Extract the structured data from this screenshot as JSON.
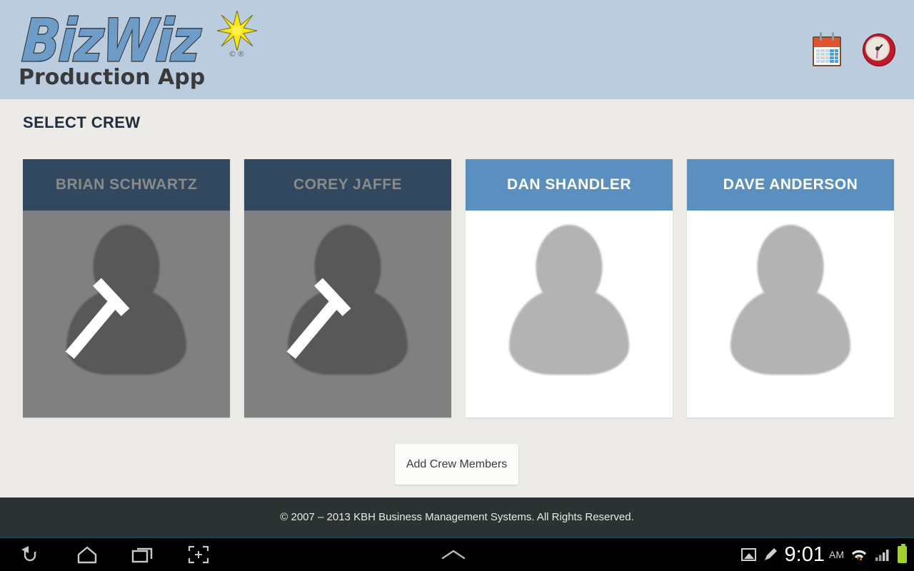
{
  "header": {
    "logo_main": "BizWiz",
    "logo_sub": "Production App",
    "logo_trademark": "©®",
    "icons": [
      {
        "name": "calendar-icon",
        "label": "Calendar"
      },
      {
        "name": "clock-icon",
        "label": "Time Clock"
      }
    ]
  },
  "main": {
    "page_title": "SELECT CREW",
    "add_button_label": "Add Crew Members",
    "crew": [
      {
        "name": "BRIAN SCHWARTZ",
        "selected": true
      },
      {
        "name": "COREY JAFFE",
        "selected": true
      },
      {
        "name": "DAN SHANDLER",
        "selected": false
      },
      {
        "name": "DAVE ANDERSON",
        "selected": false
      }
    ]
  },
  "footer": {
    "copyright": "© 2007 – 2013 KBH Business Management Systems. All Rights Reserved."
  },
  "navbar": {
    "buttons": [
      {
        "name": "back-icon",
        "label": "Back"
      },
      {
        "name": "home-icon",
        "label": "Home"
      },
      {
        "name": "recents-icon",
        "label": "Recent Apps"
      },
      {
        "name": "screenshot-icon",
        "label": "Screenshot"
      }
    ],
    "center": {
      "name": "chevron-up-icon",
      "label": "Expand"
    },
    "status": {
      "time": "9:01",
      "meridiem": "AM",
      "icons": [
        "image-icon",
        "pencil-icon",
        "wifi-icon",
        "signal-icon",
        "battery-icon"
      ]
    }
  },
  "colors": {
    "header_bg": "#bcccdf",
    "page_bg": "#edebe7",
    "card_header_unselected": "#5b8fbf",
    "card_header_selected": "#32485f",
    "card_body_selected": "#808080",
    "footer_bg": "#2a3332",
    "title_color": "#1f2d3d"
  }
}
